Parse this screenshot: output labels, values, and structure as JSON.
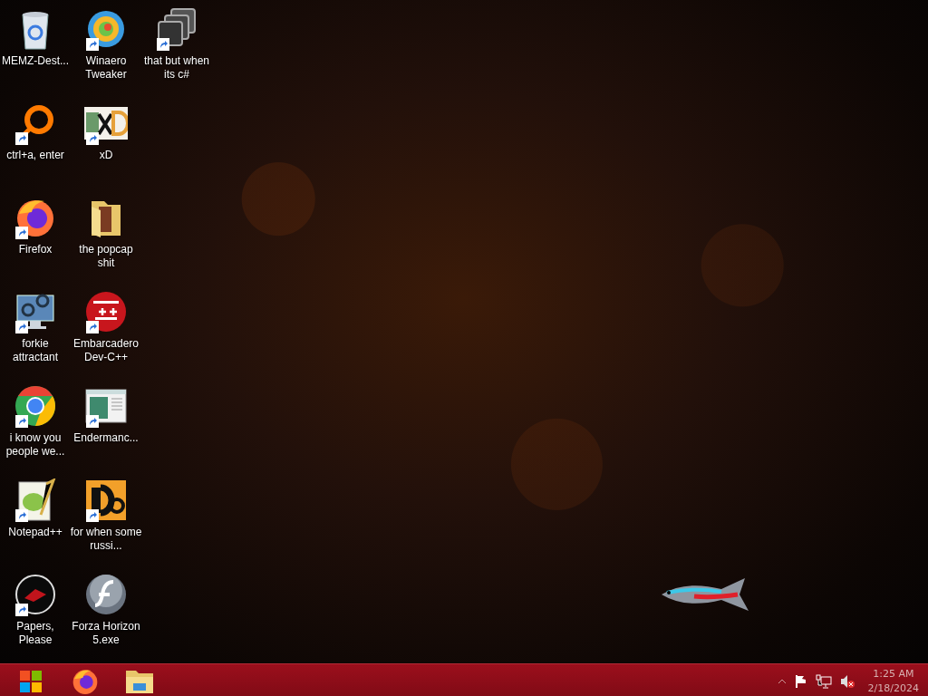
{
  "desktop_icons": [
    {
      "label": "MEMZ-Dest...",
      "kind": "recycle-bin",
      "shortcut": false
    },
    {
      "label": "ctrl+a, enter",
      "kind": "ring",
      "shortcut": true
    },
    {
      "label": "Firefox",
      "kind": "firefox",
      "shortcut": true
    },
    {
      "label": "forkie attractant",
      "kind": "gear-monitor",
      "shortcut": true
    },
    {
      "label": "i know you people we...",
      "kind": "chrome",
      "shortcut": true
    },
    {
      "label": "Notepad++",
      "kind": "notepad",
      "shortcut": true
    },
    {
      "label": "Papers, Please",
      "kind": "disc",
      "shortcut": true
    },
    {
      "label": "Winaero Tweaker",
      "kind": "swirl",
      "shortcut": true
    },
    {
      "label": "xD",
      "kind": "hex",
      "shortcut": true
    },
    {
      "label": "the popcap shit",
      "kind": "folder",
      "shortcut": false
    },
    {
      "label": "Embarcadero Dev-C++",
      "kind": "dev",
      "shortcut": true
    },
    {
      "label": "Endermanc...",
      "kind": "window",
      "shortcut": true
    },
    {
      "label": "for when some russi...",
      "kind": "de",
      "shortcut": true
    },
    {
      "label": "Forza Horizon 5.exe",
      "kind": "flash",
      "shortcut": false
    },
    {
      "label": "that but when its c#",
      "kind": "stack",
      "shortcut": true
    }
  ],
  "taskbar": {
    "pinned": [
      {
        "kind": "start"
      },
      {
        "kind": "firefox"
      },
      {
        "kind": "explorer"
      }
    ],
    "tray": {
      "time": "1:25 AM",
      "date": "2/18/2024"
    }
  }
}
